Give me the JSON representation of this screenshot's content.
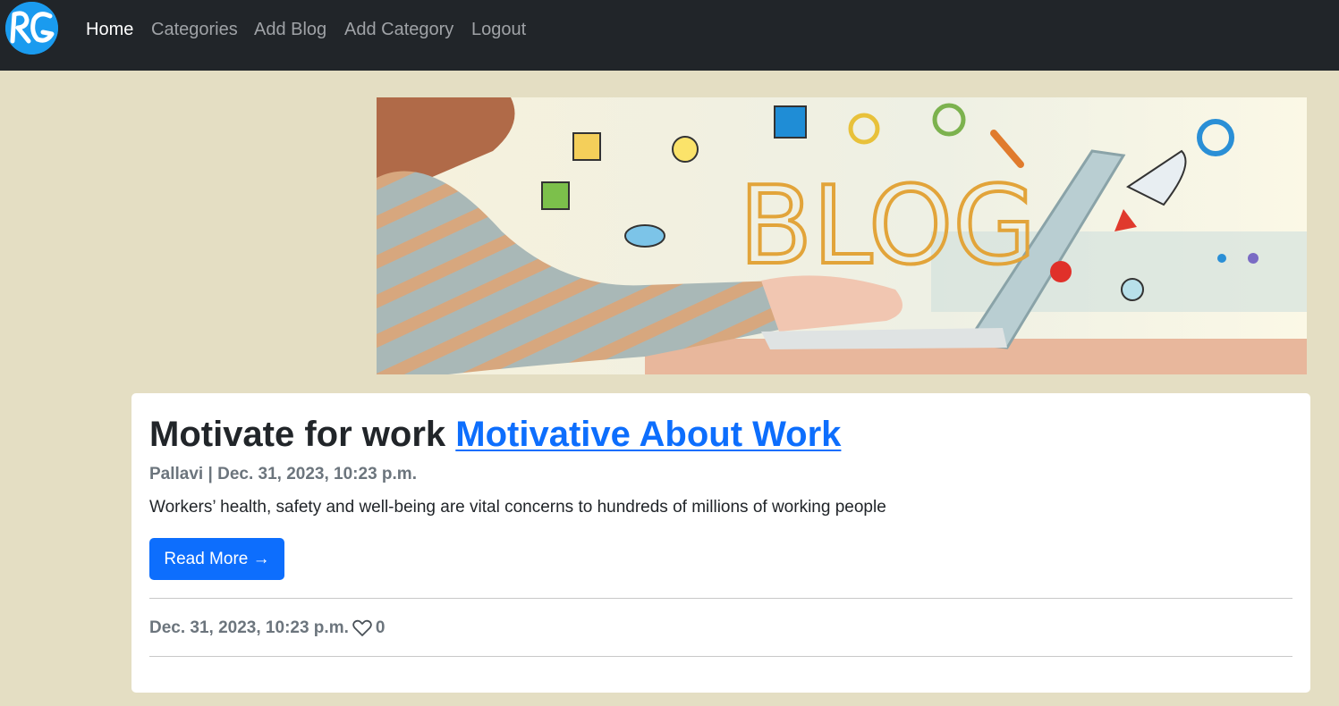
{
  "navbar": {
    "logo_text": "RG",
    "links": [
      "Home",
      "Categories",
      "Add Blog",
      "Add Category",
      "Logout"
    ],
    "active": "Home"
  },
  "hero": {
    "image": "blog-banner",
    "banner_text": "BLOG"
  },
  "post": {
    "title": "Motivate for work",
    "link_text": "Motivative About Work",
    "author": "Pallavi",
    "separator": "|",
    "date": "Dec. 31, 2023, 10:23 p.m.",
    "excerpt": "Workers’ health, safety and well-being are vital concerns to hundreds of millions of working people",
    "read_more": "Read More →",
    "footer_date": "Dec. 31, 2023, 10:23 p.m.",
    "like_icon": "heart-outline-icon",
    "like_count": "0"
  },
  "colors": {
    "navbar_bg": "#212529",
    "page_bg": "#e4dec3",
    "primary": "#0d6efd",
    "muted": "#6c757d"
  }
}
